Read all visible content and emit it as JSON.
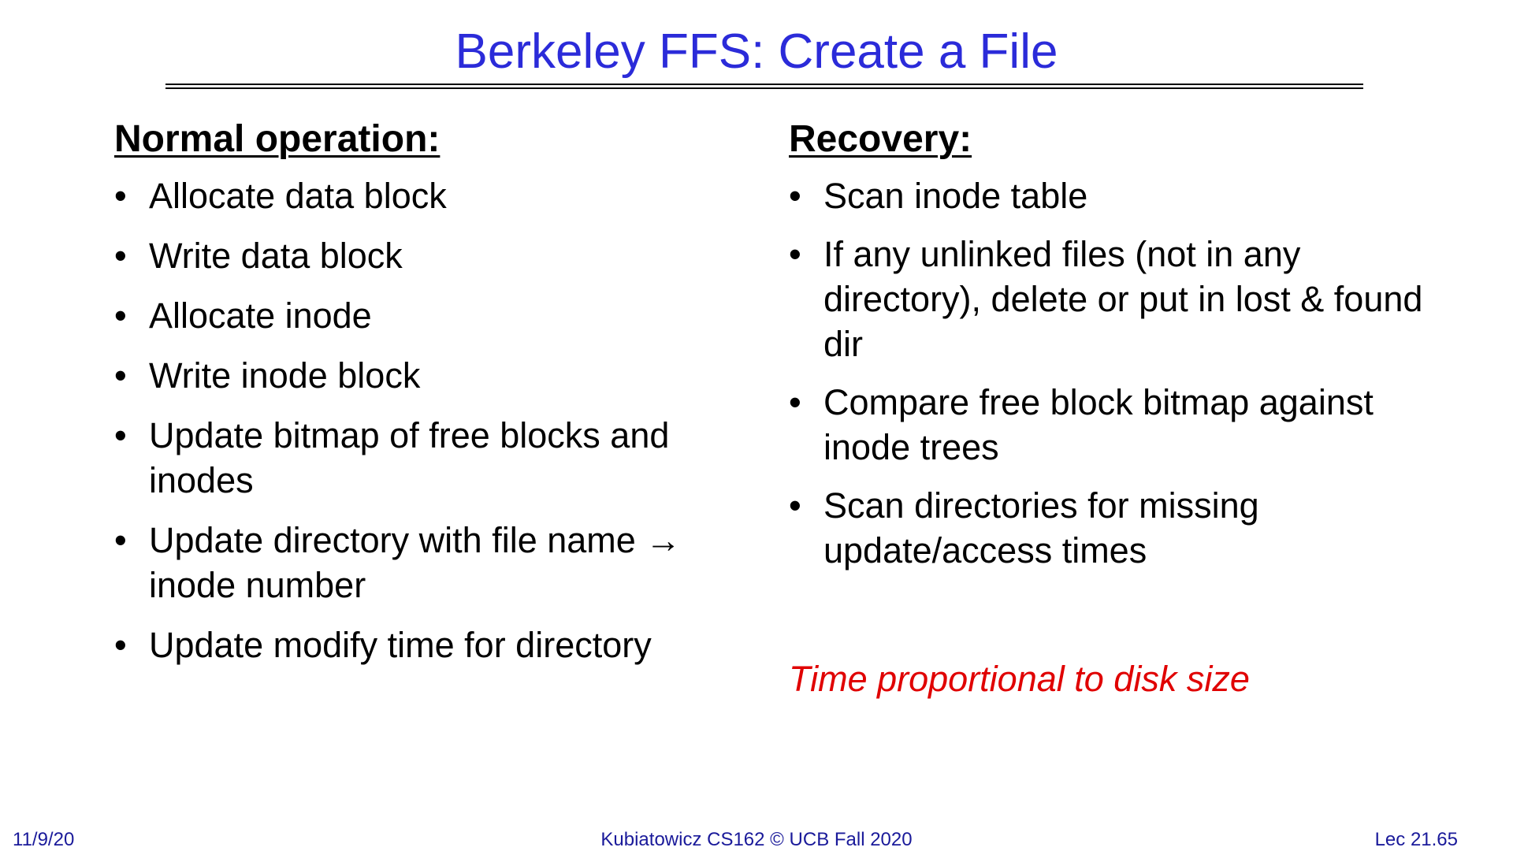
{
  "slide": {
    "title": "Berkeley FFS: Create a File"
  },
  "left": {
    "heading": "Normal operation:",
    "items": [
      "Allocate data block",
      "Write data block",
      "Allocate inode",
      "Write inode block",
      "Update bitmap of free blocks and inodes",
      "Update directory with file name → inode number",
      "Update modify time for directory"
    ]
  },
  "right": {
    "heading": "Recovery:",
    "items": [
      "Scan inode table",
      "If any unlinked files (not in any directory), delete or put in lost & found dir",
      "Compare free block bitmap against inode trees",
      "Scan directories for missing update/access times"
    ],
    "note": "Time proportional to disk size"
  },
  "footer": {
    "date": "11/9/20",
    "course": "Kubiatowicz CS162 © UCB Fall 2020",
    "lecture": "Lec 21.65"
  },
  "colors": {
    "title": "#2b2bd9",
    "note": "#e00000",
    "footer": "#1a1a9a"
  }
}
